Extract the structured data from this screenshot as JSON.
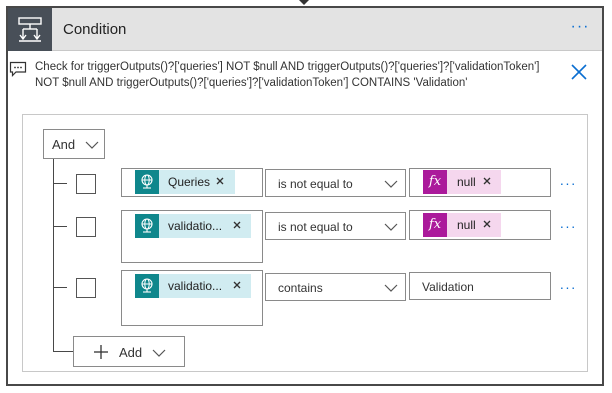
{
  "condition": {
    "title": "Condition",
    "more_label": "···",
    "description": "Check for triggerOutputs()?['queries'] NOT $null AND triggerOutputs()?['queries']?['validationToken'] NOT $null AND triggerOutputs()?['queries']?['validationToken'] CONTAINS 'Validation'"
  },
  "group": {
    "operator": "And",
    "add_label": "Add"
  },
  "rows": [
    {
      "left_token": "Queries",
      "operator": "is not equal to",
      "right_token": "null",
      "more_label": "···"
    },
    {
      "left_token": "validatio...",
      "operator": "is not equal to",
      "right_token": "null",
      "more_label": "···"
    },
    {
      "left_token": "validatio...",
      "operator": "contains",
      "right_value": "Validation",
      "more_label": "···"
    }
  ],
  "colors": {
    "header_bg": "#e3e3e3",
    "icon_bg": "#484f58",
    "accent": "#0a6ed1",
    "dynamic_token_bg": "#d1ecf1",
    "dynamic_icon_bg": "#0f878c",
    "expression_token_bg": "#f5d7ee",
    "expression_icon_bg": "#ab1a9b"
  },
  "icons": {
    "header": "condition-branch-icon",
    "description": "comment-icon",
    "close": "close-icon",
    "dynamic": "globe-icon",
    "expression": "fx-icon"
  }
}
